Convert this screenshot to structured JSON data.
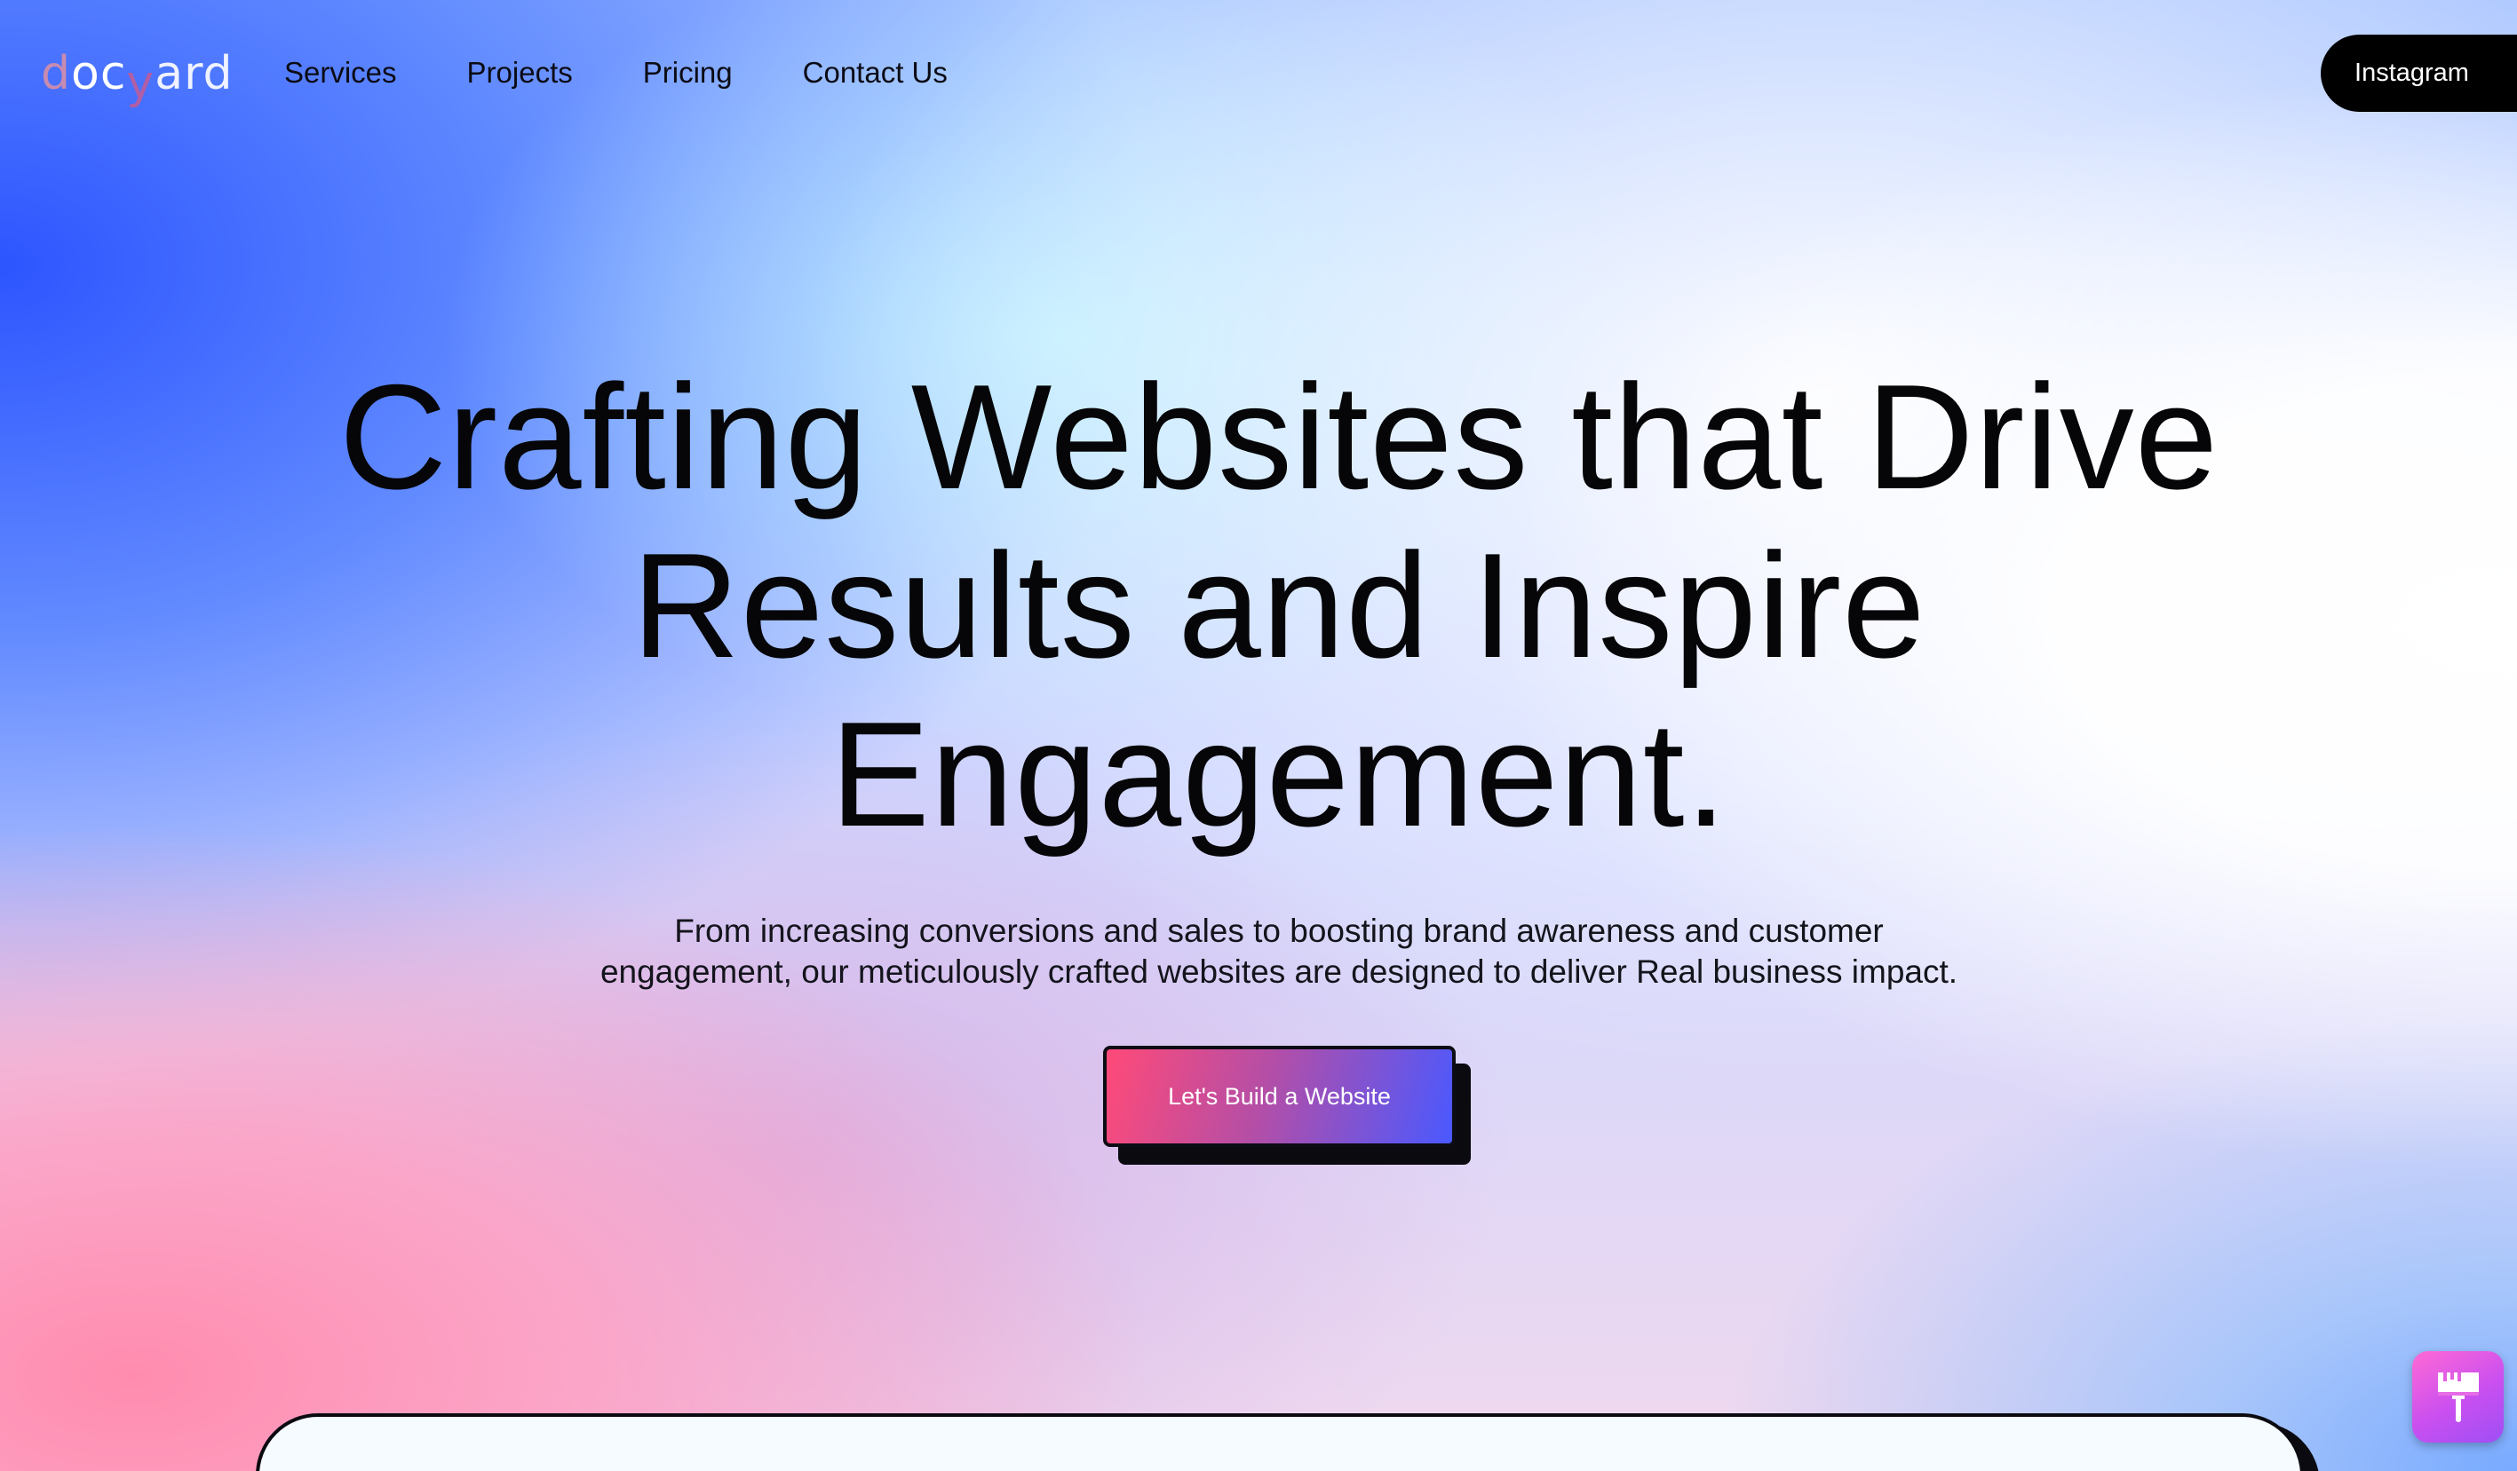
{
  "brand": {
    "logo_d": "d",
    "logo_oc": "oc",
    "logo_y": "y",
    "logo_ard": "ard"
  },
  "nav": {
    "items": [
      "Services",
      "Projects",
      "Pricing",
      "Contact Us"
    ]
  },
  "header": {
    "instagram_label": "Instagram"
  },
  "hero": {
    "headline_line1": "Crafting Websites that Drive",
    "headline_line2": "Results and Inspire",
    "headline_line3": "Engagement.",
    "subhead_line1": "From increasing conversions and sales to boosting brand awareness and customer",
    "subhead_line2": "engagement, our meticulously crafted websites are designed to deliver Real business impact.",
    "cta_label": "Let's Build a Website"
  },
  "widget": {
    "icon": "paint-brush-icon"
  },
  "colors": {
    "text": "#060608",
    "cta_gradient_start": "#ff4a78",
    "cta_gradient_end": "#4a59ff",
    "button_bg": "#000000",
    "widget_gradient_start": "#ff6ad5",
    "widget_gradient_end": "#9e4ff5"
  }
}
